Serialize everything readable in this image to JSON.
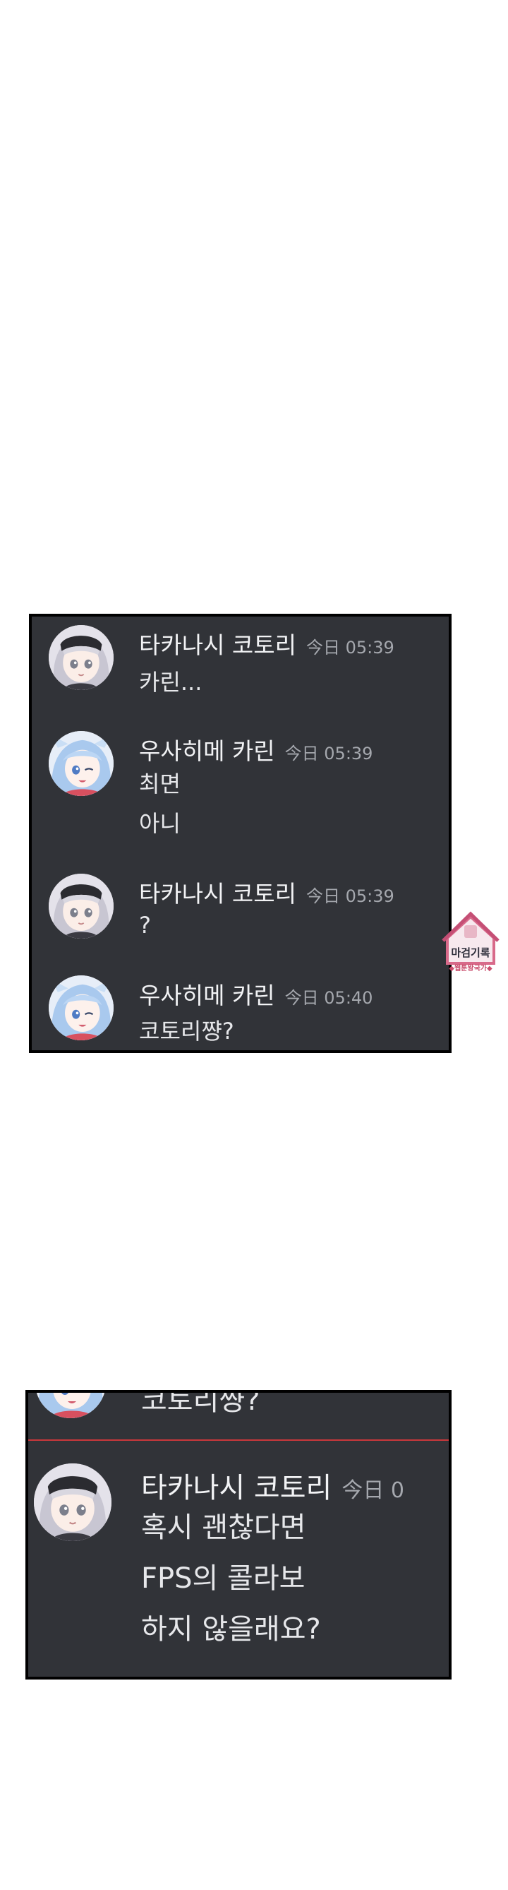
{
  "panel1": {
    "messages": [
      {
        "author": "타카나시 코토리",
        "time": "今日 05:39",
        "lines": [
          "카린..."
        ]
      },
      {
        "author": "우사히메 카린",
        "time": "今日 05:39",
        "lines": [
          "최면",
          "아니"
        ]
      },
      {
        "author": "타카나시 코토리",
        "time": "今日 05:39",
        "lines": [
          "?"
        ]
      },
      {
        "author": "우사히메 카린",
        "time": "今日 05:40",
        "lines": [
          "코토리쨩?"
        ]
      }
    ]
  },
  "panel2": {
    "prev_line": "코토리쨩?",
    "message": {
      "author": "타카나시 코토리",
      "time": "今日 0",
      "lines": [
        "혹시 괜찮다면",
        "FPS의 콜라보",
        "하지 않을래요?"
      ]
    }
  },
  "watermark": {
    "title": "마검기록",
    "subtitle": "◆웹툰왕국가◆"
  },
  "colors": {
    "panel_bg": "#313338",
    "author": "#f2f3f5",
    "timestamp": "#a5a8ae",
    "message_text": "#e6e7ea",
    "new_divider": "#c9373b"
  }
}
